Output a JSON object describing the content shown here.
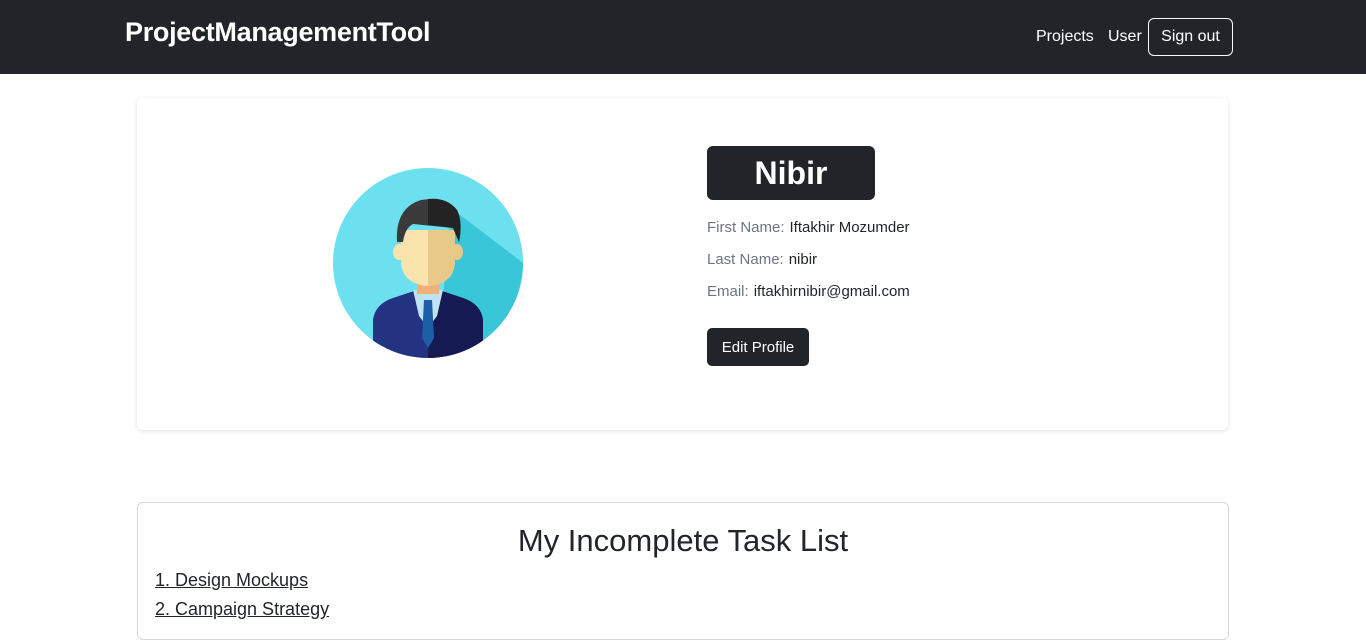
{
  "navbar": {
    "brand": "ProjectManagementTool",
    "links": [
      {
        "label": "Projects"
      },
      {
        "label": "User"
      }
    ],
    "signout_label": "Sign out"
  },
  "profile": {
    "username": "Nibir",
    "avatar_icon": "man-avatar-icon",
    "fields": [
      {
        "label": "First Name:",
        "value": "Iftakhir Mozumder"
      },
      {
        "label": "Last Name:",
        "value": "nibir"
      },
      {
        "label": "Email:",
        "value": "iftakhirnibir@gmail.com"
      }
    ],
    "edit_label": "Edit Profile"
  },
  "tasks": {
    "title": "My Incomplete Task List",
    "items": [
      {
        "label": "1. Design Mockups"
      },
      {
        "label": "2. Campaign Strategy"
      }
    ]
  },
  "colors": {
    "navbar_bg": "#212529",
    "avatar_bg": "#6de0ef",
    "avatar_shadow": "#38c6d8"
  }
}
